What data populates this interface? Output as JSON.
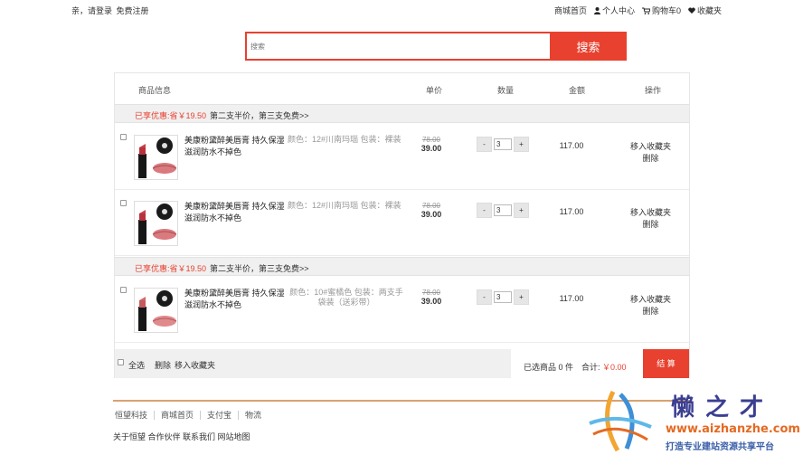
{
  "topbar": {
    "greeting": "亲，请登录",
    "register": "免费注册",
    "nav": {
      "home": "商城首页",
      "user_center": "个人中心",
      "cart": "购物车0",
      "favorites": "收藏夹"
    },
    "icons": [
      "user-icon",
      "cart-icon",
      "heart-icon"
    ]
  },
  "search": {
    "placeholder": "搜索",
    "button": "搜索",
    "accent": "#e8412f"
  },
  "cart": {
    "headers": {
      "product": "商品信息",
      "price": "单价",
      "quantity": "数量",
      "amount": "金额",
      "actions": "操作"
    },
    "groups": [
      {
        "promo_tag": "已享优惠:省￥19.50",
        "promo_desc": "第二支半价，第三支免费>>",
        "items": [
          {
            "name": "美康粉黛醉美唇膏 持久保湿滋润防水不掉色",
            "attr": "颜色：12#川南玛瑙 包装：裸装",
            "orig_price": "78.00",
            "price": "39.00",
            "qty": "3",
            "minus": "-",
            "plus": "+",
            "amount": "117.00",
            "op_fav": "移入收藏夹",
            "op_del": "删除"
          },
          {
            "name": "美康粉黛醉美唇膏 持久保湿滋润防水不掉色",
            "attr": "颜色：12#川南玛瑙 包装：裸装",
            "orig_price": "78.00",
            "price": "39.00",
            "qty": "3",
            "minus": "-",
            "plus": "+",
            "amount": "117.00",
            "op_fav": "移入收藏夹",
            "op_del": "删除"
          }
        ]
      },
      {
        "promo_tag": "已享优惠:省￥19.50",
        "promo_desc": "第二支半价，第三支免费>>",
        "items": [
          {
            "name": "美康粉黛醉美唇膏 持久保湿滋润防水不掉色",
            "attr": "颜色：10#蜜橘色 包装：两支手袋装（送彩带）",
            "orig_price": "78.00",
            "price": "39.00",
            "qty": "3",
            "minus": "-",
            "plus": "+",
            "amount": "117.00",
            "op_fav": "移入收藏夹",
            "op_del": "删除"
          }
        ]
      }
    ],
    "footer": {
      "select_all": "全选",
      "delete": "删除",
      "move_fav": "移入收藏夹",
      "selected": "已选商品  0  件",
      "total_label": "合计:",
      "total_value": "￥0.00",
      "checkout": "结 算"
    }
  },
  "footer": {
    "links": [
      "恒望科技",
      "商城首页",
      "支付宝",
      "物流"
    ],
    "bottom": "关于恒望 合作伙伴 联系我们 网站地图"
  },
  "watermark": {
    "brand": "懒之才",
    "url": "www.aizhanzhe.com",
    "slogan": "打造专业建站资源共享平台"
  }
}
